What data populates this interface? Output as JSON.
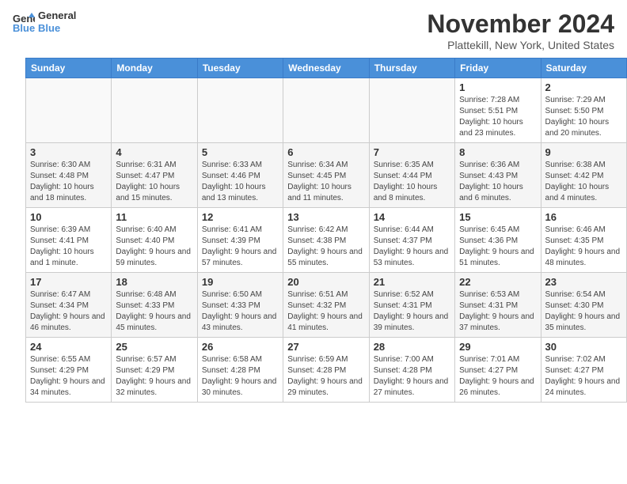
{
  "header": {
    "logo_line1": "General",
    "logo_line2": "Blue",
    "title": "November 2024",
    "subtitle": "Plattekill, New York, United States"
  },
  "weekdays": [
    "Sunday",
    "Monday",
    "Tuesday",
    "Wednesday",
    "Thursday",
    "Friday",
    "Saturday"
  ],
  "weeks": [
    [
      {
        "day": "",
        "info": ""
      },
      {
        "day": "",
        "info": ""
      },
      {
        "day": "",
        "info": ""
      },
      {
        "day": "",
        "info": ""
      },
      {
        "day": "",
        "info": ""
      },
      {
        "day": "1",
        "info": "Sunrise: 7:28 AM\nSunset: 5:51 PM\nDaylight: 10 hours and 23 minutes."
      },
      {
        "day": "2",
        "info": "Sunrise: 7:29 AM\nSunset: 5:50 PM\nDaylight: 10 hours and 20 minutes."
      }
    ],
    [
      {
        "day": "3",
        "info": "Sunrise: 6:30 AM\nSunset: 4:48 PM\nDaylight: 10 hours and 18 minutes."
      },
      {
        "day": "4",
        "info": "Sunrise: 6:31 AM\nSunset: 4:47 PM\nDaylight: 10 hours and 15 minutes."
      },
      {
        "day": "5",
        "info": "Sunrise: 6:33 AM\nSunset: 4:46 PM\nDaylight: 10 hours and 13 minutes."
      },
      {
        "day": "6",
        "info": "Sunrise: 6:34 AM\nSunset: 4:45 PM\nDaylight: 10 hours and 11 minutes."
      },
      {
        "day": "7",
        "info": "Sunrise: 6:35 AM\nSunset: 4:44 PM\nDaylight: 10 hours and 8 minutes."
      },
      {
        "day": "8",
        "info": "Sunrise: 6:36 AM\nSunset: 4:43 PM\nDaylight: 10 hours and 6 minutes."
      },
      {
        "day": "9",
        "info": "Sunrise: 6:38 AM\nSunset: 4:42 PM\nDaylight: 10 hours and 4 minutes."
      }
    ],
    [
      {
        "day": "10",
        "info": "Sunrise: 6:39 AM\nSunset: 4:41 PM\nDaylight: 10 hours and 1 minute."
      },
      {
        "day": "11",
        "info": "Sunrise: 6:40 AM\nSunset: 4:40 PM\nDaylight: 9 hours and 59 minutes."
      },
      {
        "day": "12",
        "info": "Sunrise: 6:41 AM\nSunset: 4:39 PM\nDaylight: 9 hours and 57 minutes."
      },
      {
        "day": "13",
        "info": "Sunrise: 6:42 AM\nSunset: 4:38 PM\nDaylight: 9 hours and 55 minutes."
      },
      {
        "day": "14",
        "info": "Sunrise: 6:44 AM\nSunset: 4:37 PM\nDaylight: 9 hours and 53 minutes."
      },
      {
        "day": "15",
        "info": "Sunrise: 6:45 AM\nSunset: 4:36 PM\nDaylight: 9 hours and 51 minutes."
      },
      {
        "day": "16",
        "info": "Sunrise: 6:46 AM\nSunset: 4:35 PM\nDaylight: 9 hours and 48 minutes."
      }
    ],
    [
      {
        "day": "17",
        "info": "Sunrise: 6:47 AM\nSunset: 4:34 PM\nDaylight: 9 hours and 46 minutes."
      },
      {
        "day": "18",
        "info": "Sunrise: 6:48 AM\nSunset: 4:33 PM\nDaylight: 9 hours and 45 minutes."
      },
      {
        "day": "19",
        "info": "Sunrise: 6:50 AM\nSunset: 4:33 PM\nDaylight: 9 hours and 43 minutes."
      },
      {
        "day": "20",
        "info": "Sunrise: 6:51 AM\nSunset: 4:32 PM\nDaylight: 9 hours and 41 minutes."
      },
      {
        "day": "21",
        "info": "Sunrise: 6:52 AM\nSunset: 4:31 PM\nDaylight: 9 hours and 39 minutes."
      },
      {
        "day": "22",
        "info": "Sunrise: 6:53 AM\nSunset: 4:31 PM\nDaylight: 9 hours and 37 minutes."
      },
      {
        "day": "23",
        "info": "Sunrise: 6:54 AM\nSunset: 4:30 PM\nDaylight: 9 hours and 35 minutes."
      }
    ],
    [
      {
        "day": "24",
        "info": "Sunrise: 6:55 AM\nSunset: 4:29 PM\nDaylight: 9 hours and 34 minutes."
      },
      {
        "day": "25",
        "info": "Sunrise: 6:57 AM\nSunset: 4:29 PM\nDaylight: 9 hours and 32 minutes."
      },
      {
        "day": "26",
        "info": "Sunrise: 6:58 AM\nSunset: 4:28 PM\nDaylight: 9 hours and 30 minutes."
      },
      {
        "day": "27",
        "info": "Sunrise: 6:59 AM\nSunset: 4:28 PM\nDaylight: 9 hours and 29 minutes."
      },
      {
        "day": "28",
        "info": "Sunrise: 7:00 AM\nSunset: 4:28 PM\nDaylight: 9 hours and 27 minutes."
      },
      {
        "day": "29",
        "info": "Sunrise: 7:01 AM\nSunset: 4:27 PM\nDaylight: 9 hours and 26 minutes."
      },
      {
        "day": "30",
        "info": "Sunrise: 7:02 AM\nSunset: 4:27 PM\nDaylight: 9 hours and 24 minutes."
      }
    ]
  ]
}
